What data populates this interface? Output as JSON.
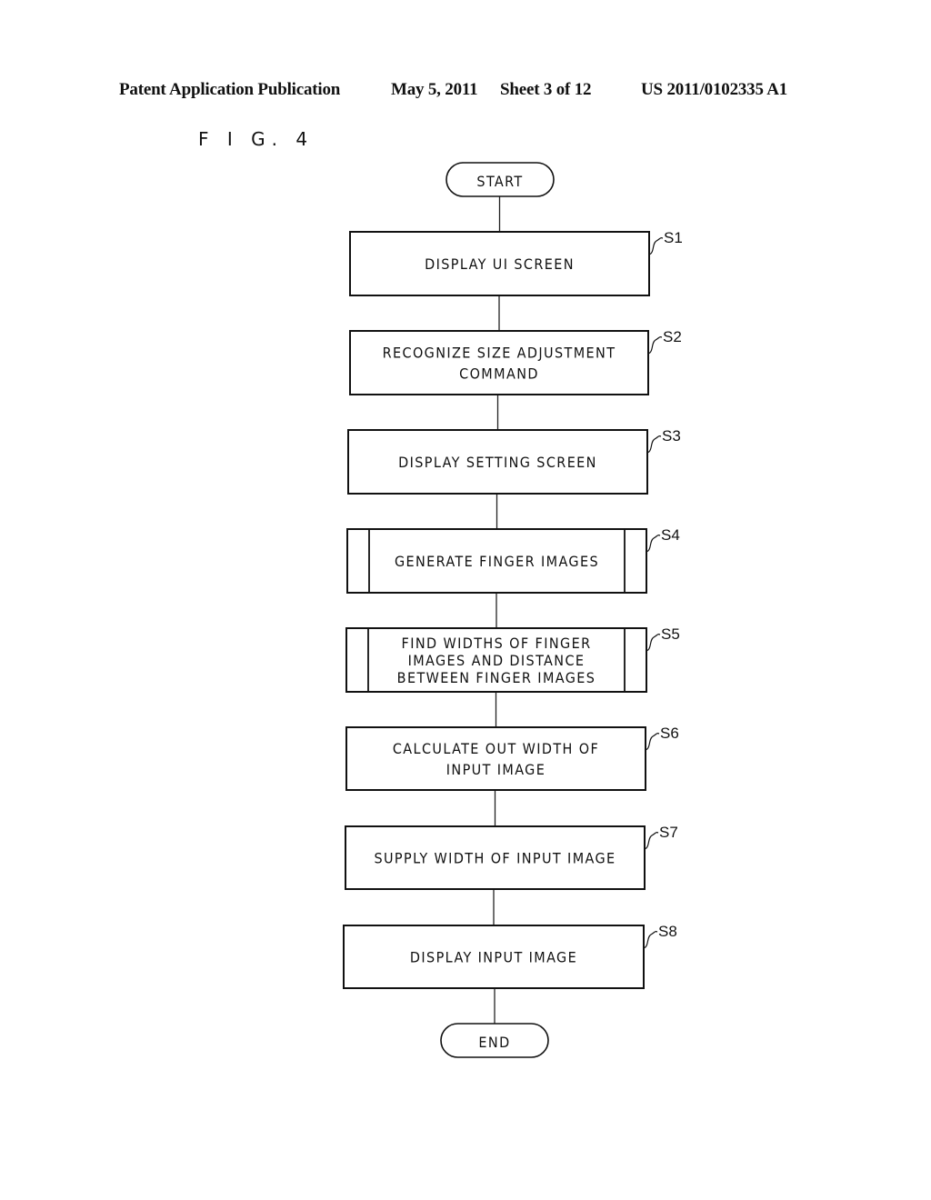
{
  "header": {
    "publication": "Patent Application Publication",
    "date": "May 5, 2011",
    "sheet": "Sheet 3 of 12",
    "number": "US 2011/0102335 A1"
  },
  "figure": {
    "label": "F I G. 4",
    "start": "START",
    "end": "END",
    "steps": [
      {
        "id": "S1",
        "type": "process",
        "lines": [
          "DISPLAY UI SCREEN"
        ]
      },
      {
        "id": "S2",
        "type": "process",
        "lines": [
          "RECOGNIZE SIZE ADJUSTMENT",
          "COMMAND"
        ]
      },
      {
        "id": "S3",
        "type": "process",
        "lines": [
          "DISPLAY SETTING SCREEN"
        ]
      },
      {
        "id": "S4",
        "type": "subroutine",
        "lines": [
          "GENERATE FINGER IMAGES"
        ]
      },
      {
        "id": "S5",
        "type": "subroutine",
        "lines": [
          "FIND WIDTHS OF FINGER",
          "IMAGES AND DISTANCE",
          "BETWEEN FINGER IMAGES"
        ]
      },
      {
        "id": "S6",
        "type": "process",
        "lines": [
          "CALCULATE OUT WIDTH OF",
          "INPUT IMAGE"
        ]
      },
      {
        "id": "S7",
        "type": "process",
        "lines": [
          "SUPPLY WIDTH OF INPUT IMAGE"
        ]
      },
      {
        "id": "S8",
        "type": "process",
        "lines": [
          "DISPLAY INPUT IMAGE"
        ]
      }
    ]
  }
}
